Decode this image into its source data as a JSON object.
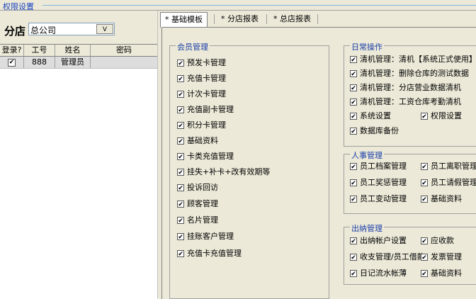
{
  "window_title": "权限设置",
  "branch": {
    "label": "分店",
    "selected": "总公司",
    "dropdown_button": "V"
  },
  "grid": {
    "headers": [
      "登录?",
      "工号",
      "姓名",
      "密码"
    ],
    "rows": [
      {
        "checked": "✔",
        "id": "888",
        "name": "管理员",
        "password": ""
      }
    ]
  },
  "tabs": [
    "* 基础模板",
    "* 分店报表",
    "* 总店报表"
  ],
  "check_mark": "✔",
  "groups": {
    "member": {
      "title": "会员管理",
      "items": [
        "预发卡管理",
        "充值卡管理",
        "计次卡管理",
        "充值副卡管理",
        "积分卡管理",
        "基础资料",
        "卡类充值管理",
        "挂失+补卡+改有效期等",
        "投诉回访",
        "顾客管理",
        "名片管理",
        "挂账客户管理",
        "充值卡充值管理"
      ]
    },
    "daily": {
      "title": "日常操作",
      "items": [
        "清机管理：清机【系统正式使用】",
        "清机管理：删除仓库的测试数据",
        "清机管理：分店营业数据清机",
        "清机管理：工资仓库考勤清机",
        "系统设置",
        "权限设置",
        "数据库备份"
      ]
    },
    "hr": {
      "title": "人事管理",
      "items": [
        "员工档案管理",
        "员工离职管理",
        "员工奖惩管理",
        "员工请假管理",
        "员工变动管理",
        "基础资料"
      ]
    },
    "cashier": {
      "title": "出纳管理",
      "items": [
        "出纳帐户设置",
        "应收款",
        "收支管理/员工借款",
        "发票管理",
        "日记流水帐薄",
        "基础资料"
      ]
    }
  }
}
